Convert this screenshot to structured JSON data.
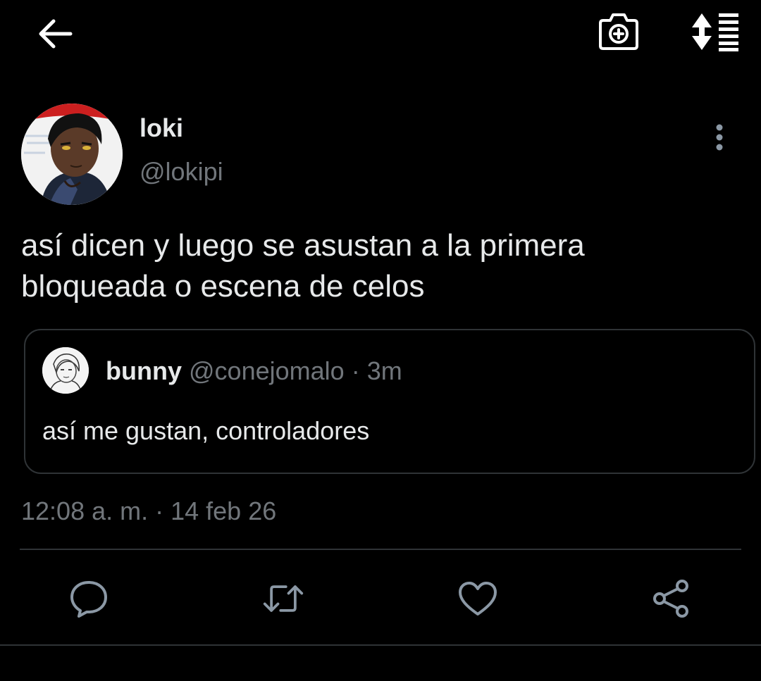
{
  "topbar": {
    "back_icon": "arrow-left-icon",
    "camera_icon": "camera-plus-icon",
    "sort_icon": "sort-lines-icon"
  },
  "tweet": {
    "author": {
      "display_name": "loki",
      "handle": "@lokipi"
    },
    "text_line1": "así dicen y luego se asustan a la primera",
    "text_line2": "bloqueada o escena de celos",
    "timestamp": "12:08 a. m. · 14 feb 26"
  },
  "quoted": {
    "display_name": "bunny",
    "handle": "@conejomalo",
    "separator": "·",
    "age": "3m",
    "text": "así me gustan, controladores"
  },
  "actions": [
    {
      "name": "reply",
      "icon": "comment-icon"
    },
    {
      "name": "retweet",
      "icon": "retweet-icon"
    },
    {
      "name": "like",
      "icon": "heart-icon"
    },
    {
      "name": "share",
      "icon": "share-icon"
    }
  ],
  "colors": {
    "background": "#000000",
    "primary_text": "#e7e9ea",
    "secondary_text": "#71767b",
    "border": "#2f3336",
    "icon": "#8b98a5"
  }
}
